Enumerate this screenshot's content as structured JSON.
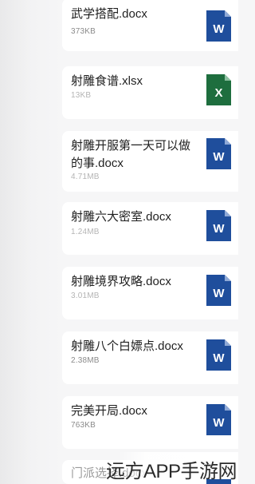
{
  "files": [
    {
      "name": "武学搭配.docx",
      "size": "373KB",
      "type": "word",
      "icon": "word-icon"
    },
    {
      "name": "射雕食谱.xlsx",
      "size": "13KB",
      "type": "excel",
      "icon": "excel-icon"
    },
    {
      "name": "射雕开服第一天可以做的事.docx",
      "size": "4.71MB",
      "type": "word",
      "icon": "word-icon"
    },
    {
      "name": "射雕六大密室.docx",
      "size": "1.24MB",
      "type": "word",
      "icon": "word-icon"
    },
    {
      "name": "射雕境界攻略.docx",
      "size": "3.01MB",
      "type": "word",
      "icon": "word-icon"
    },
    {
      "name": "射雕八个白嫖点.docx",
      "size": "2.38MB",
      "type": "word",
      "icon": "word-icon"
    },
    {
      "name": "完美开局.docx",
      "size": "763KB",
      "type": "word",
      "icon": "word-icon"
    },
    {
      "name": "门派选择.docx",
      "size": "",
      "type": "word",
      "icon": "word-icon"
    }
  ],
  "icon_letters": {
    "word": "W",
    "excel": "X"
  },
  "colors": {
    "word": "#1f4e9c",
    "excel": "#1e6e3e"
  },
  "watermark": "远方APP手游网"
}
